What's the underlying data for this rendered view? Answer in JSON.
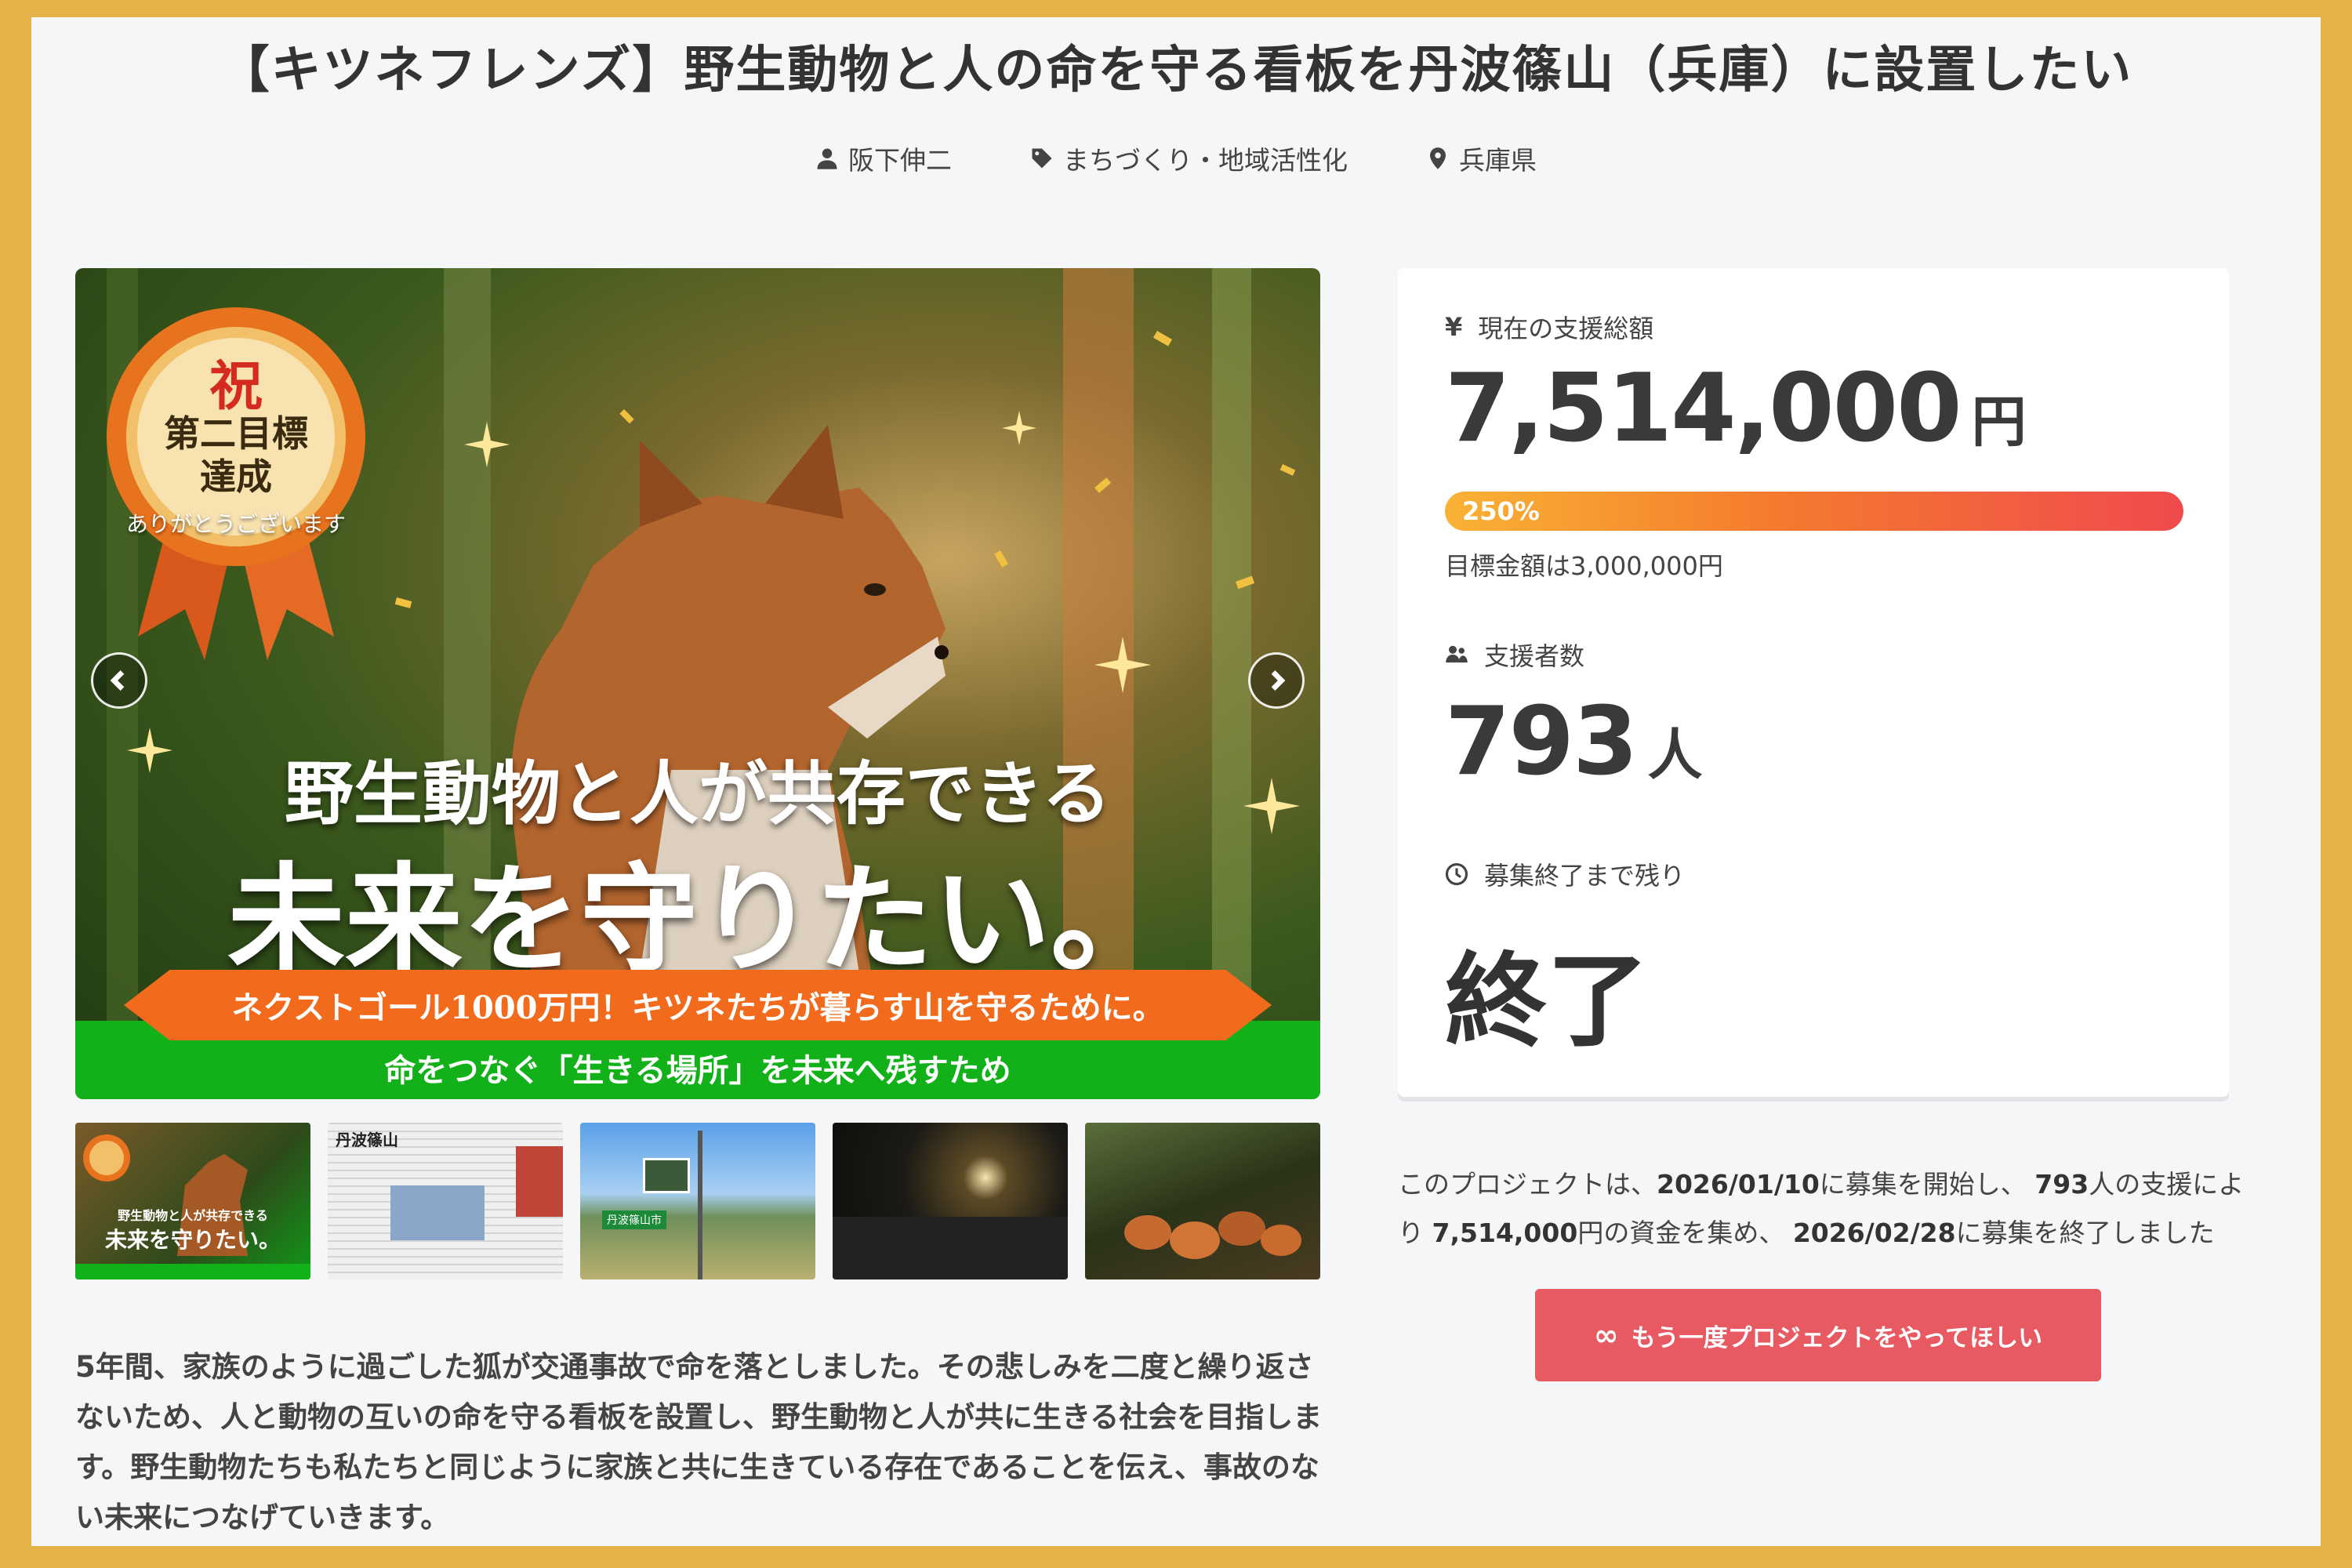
{
  "title": "【キツネフレンズ】野生動物と人の命を守る看板を丹波篠山（兵庫）に設置したい",
  "meta": {
    "author": "阪下伸二",
    "category": "まちづくり・地域活性化",
    "location": "兵庫県",
    "icons": [
      "user-icon",
      "tag-icon",
      "location-pin-icon"
    ]
  },
  "hero": {
    "badge_kanji": "祝",
    "badge_line1": "第二目標",
    "badge_line2": "達成",
    "badge_thanks": "ありがとうございます",
    "headline1": "野生動物と人が共存できる",
    "headline2": "未来を守りたい。",
    "ribbon": "ネクストゴール1000万円！キツネたちが暮らす山を守るために。",
    "band": "命をつなぐ「生きる場所」を未来へ残すため",
    "colors": {
      "ribbon": "#f26a1b",
      "band": "#12b11a"
    }
  },
  "thumbnails": [
    {
      "thumb1_line1": "野生動物と人が共存できる",
      "thumb1_line2": "未来を守りたい。"
    },
    {
      "thumb2_heading": "丹波篠山"
    },
    {
      "thumb3_sign": "丹波篠山市"
    },
    {},
    {}
  ],
  "funding": {
    "amount_label": "現在の支援総額",
    "amount": "7,514,000",
    "amount_unit": "円",
    "progress_percent": 250,
    "progress_label": "250%",
    "goal_text": "目標金額は3,000,000円",
    "backers_label": "支援者数",
    "backers": "793",
    "backers_unit": "人",
    "remaining_label": "募集終了まで残り",
    "remaining_value": "終了"
  },
  "description": "5年間、家族のように過ごした狐が交通事故で命を落としました。その悲しみを二度と繰り返さないため、人と動物の互いの命を守る看板を設置し、野生動物と人が共に生きる社会を目指します。野生動物たちも私たちと同じように家族と共に生きている存在であることを伝え、事故のない未来につなげていきます。",
  "summary": {
    "part1": "このプロジェクトは、",
    "start_date": "2026/01/10",
    "part2": "に募集を開始し、 ",
    "backers": "793",
    "part3": "人の支援により ",
    "amount": "7,514,000",
    "part4": "円の資金を集め、 ",
    "end_date": "2026/02/28",
    "part5": "に募集を終了しました"
  },
  "cta": {
    "icon": "infinity-icon",
    "label": "もう一度プロジェクトをやってほしい",
    "color": "#e85a62"
  }
}
